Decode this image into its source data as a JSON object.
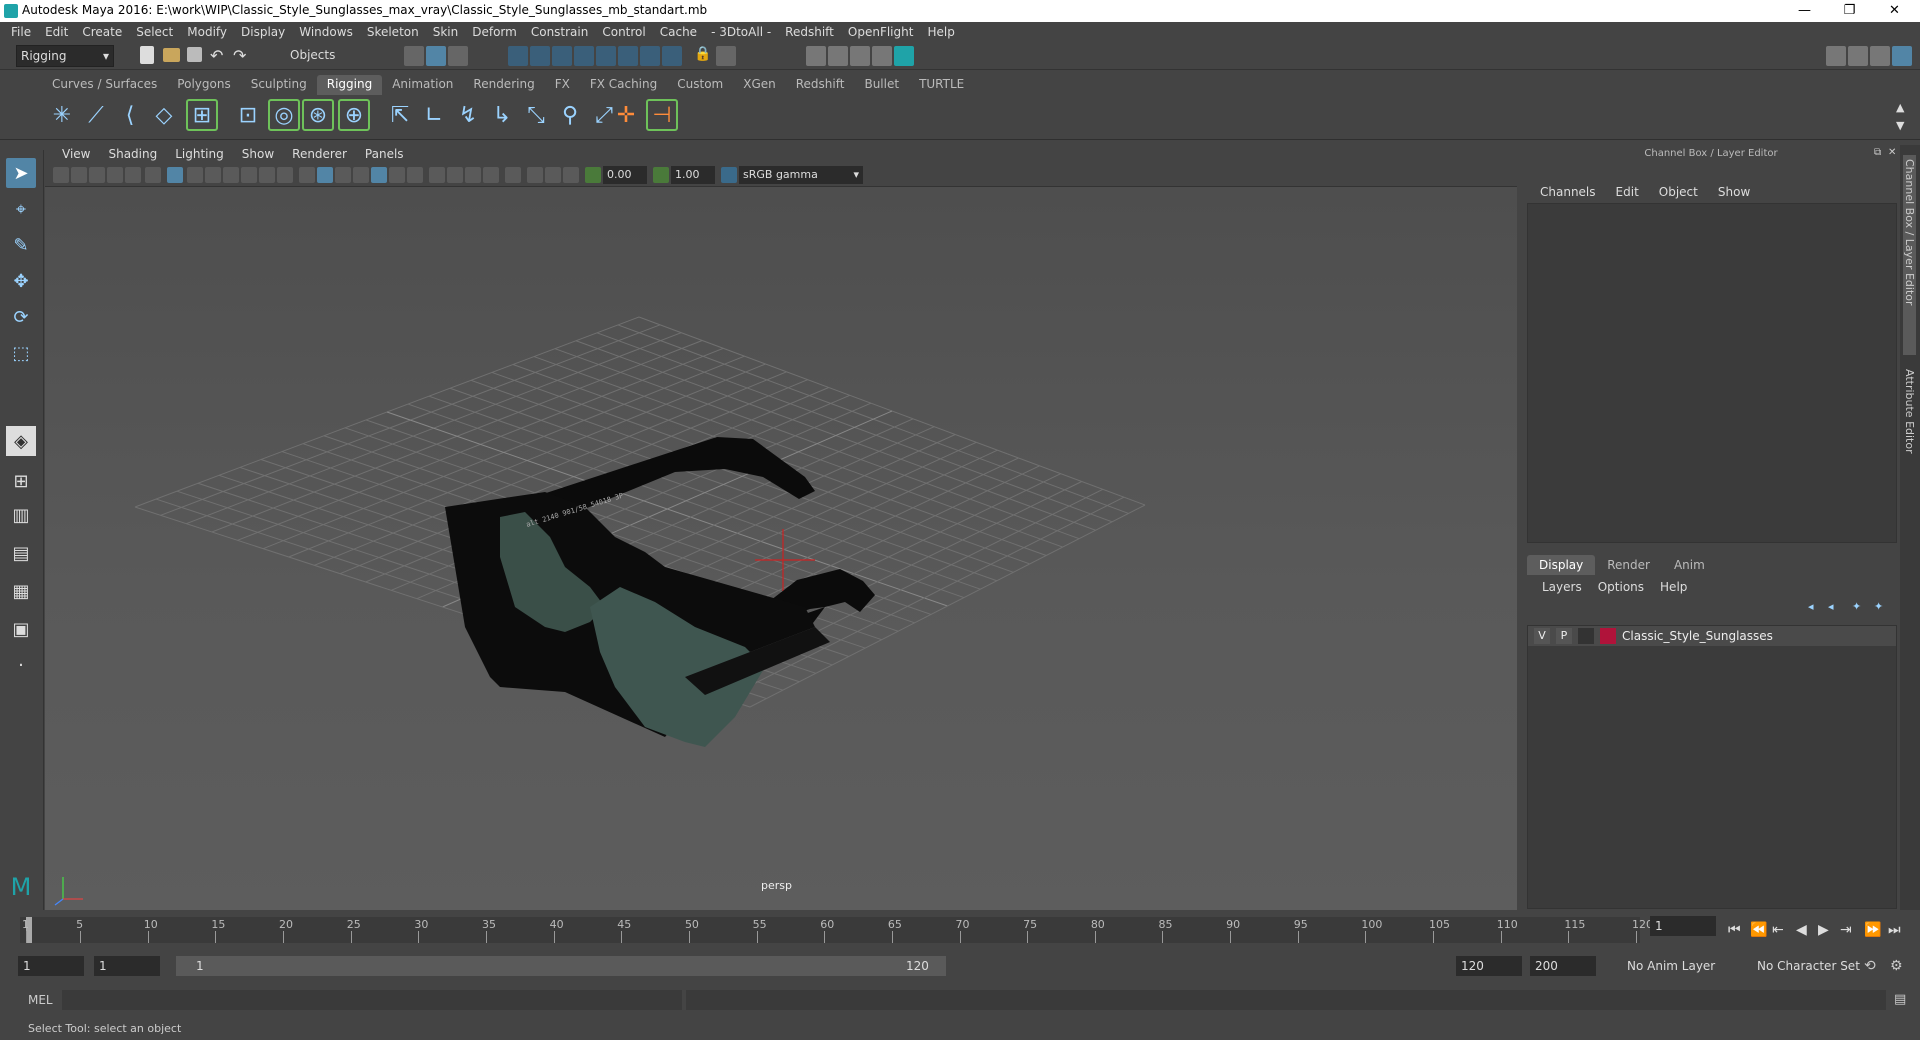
{
  "window": {
    "title": "Autodesk Maya 2016: E:\\work\\WIP\\Classic_Style_Sunglasses_max_vray\\Classic_Style_Sunglasses_mb_standart.mb",
    "min": "—",
    "max": "❐",
    "close": "✕"
  },
  "menu": [
    "File",
    "Edit",
    "Create",
    "Select",
    "Modify",
    "Display",
    "Windows",
    "Skeleton",
    "Skin",
    "Deform",
    "Constrain",
    "Control",
    "Cache",
    "- 3DtoAll -",
    "Redshift",
    "OpenFlight",
    "Help"
  ],
  "status": {
    "mode": "Rigging",
    "select_mode": "Objects"
  },
  "shelf_tabs": [
    "Curves / Surfaces",
    "Polygons",
    "Sculpting",
    "Rigging",
    "Animation",
    "Rendering",
    "FX",
    "FX Caching",
    "Custom",
    "XGen",
    "Redshift",
    "Bullet",
    "TURTLE"
  ],
  "active_shelf": "Rigging",
  "viewport": {
    "menu": [
      "View",
      "Shading",
      "Lighting",
      "Show",
      "Renderer",
      "Panels"
    ],
    "near": "0.00",
    "far": "1.00",
    "color_space": "sRGB gamma",
    "camera": "persp",
    "frame_text": "alt 2140   901/58  54018 3P"
  },
  "right_panel": {
    "title": "Channel Box / Layer Editor",
    "cb_menu": [
      "Channels",
      "Edit",
      "Object",
      "Show"
    ],
    "layer_tabs": [
      "Display",
      "Render",
      "Anim"
    ],
    "active_layer_tab": "Display",
    "layer_menu": [
      "Layers",
      "Options",
      "Help"
    ],
    "layer": {
      "v": "V",
      "p": "P",
      "name": "Classic_Style_Sunglasses",
      "color": "#b0133a"
    },
    "side_tabs": [
      "Channel Box / Layer Editor",
      "Attribute Editor"
    ]
  },
  "timeline": {
    "labels": [
      "1",
      "5",
      "10",
      "15",
      "20",
      "25",
      "30",
      "35",
      "40",
      "45",
      "50",
      "55",
      "60",
      "65",
      "70",
      "75",
      "80",
      "85",
      "90",
      "95",
      "100",
      "105",
      "110",
      "115",
      "120"
    ],
    "current_frame": "1"
  },
  "range": {
    "start": "1",
    "inner_start": "1",
    "slider_start": "1",
    "slider_end": "120",
    "end": "120",
    "max_end": "200",
    "anim_layer": "No Anim Layer",
    "char_set": "No Character Set"
  },
  "mel": {
    "label": "MEL"
  },
  "help_line": "Select Tool: select an object",
  "colors": {
    "accent": "#5285a6",
    "grid": "#777777",
    "origin": "#cc2222"
  }
}
